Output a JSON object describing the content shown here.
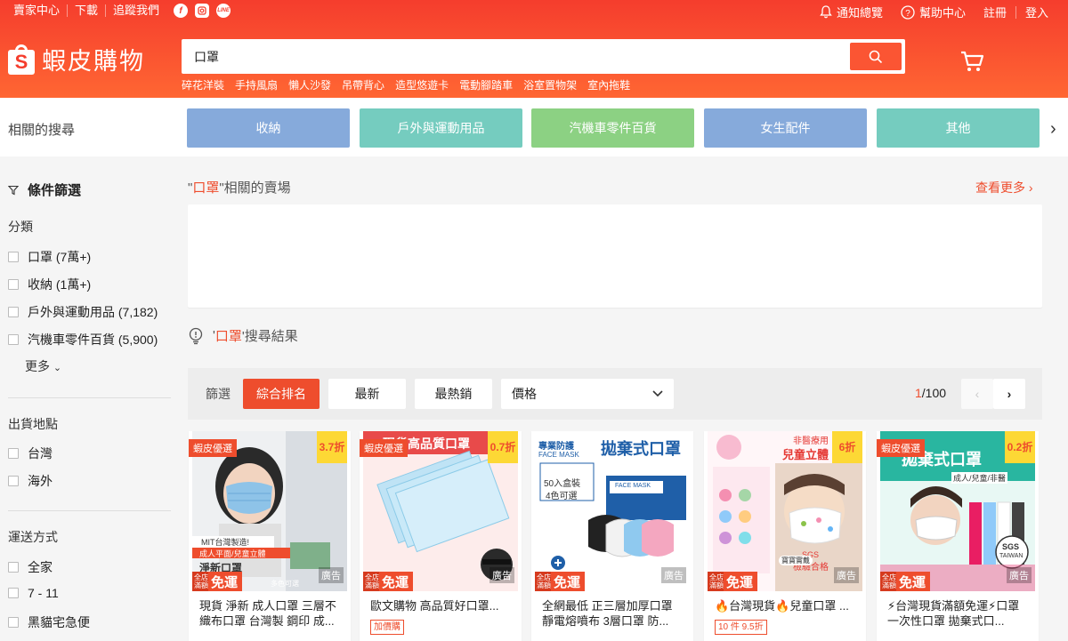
{
  "topbar": {
    "seller_center": "賣家中心",
    "download": "下載",
    "follow_us": "追蹤我們",
    "notifications": "通知總覽",
    "help_center": "幫助中心",
    "register": "註冊",
    "login": "登入"
  },
  "brand": {
    "logo_text": "蝦皮購物"
  },
  "search": {
    "query": "口罩",
    "hot_words": [
      "碎花洋裝",
      "手持風扇",
      "懶人沙發",
      "吊帶背心",
      "造型悠遊卡",
      "電動腳踏車",
      "浴室置物架",
      "室內拖鞋"
    ]
  },
  "related": {
    "label": "相關的搜尋",
    "categories": [
      {
        "label": "收納",
        "color": "#86aadb"
      },
      {
        "label": "戶外與運動用品",
        "color": "#75ccbf"
      },
      {
        "label": "汽機車零件百貨",
        "color": "#8cd183"
      },
      {
        "label": "女生配件",
        "color": "#86aadb"
      },
      {
        "label": "其他",
        "color": "#75ccbf"
      }
    ]
  },
  "filters": {
    "title": "條件篩選",
    "category_title": "分類",
    "categories": [
      "口罩 (7萬+)",
      "收納 (1萬+)",
      "戶外與運動用品 (7,182)",
      "汽機車零件百貨 (5,900)"
    ],
    "more": "更多",
    "location_title": "出貨地點",
    "locations": [
      "台灣",
      "海外"
    ],
    "shipping_title": "運送方式",
    "shipping": [
      "全家",
      "7 - 11",
      "黑貓宅急便"
    ]
  },
  "shops": {
    "heading_prefix": "\"",
    "keyword": "口罩",
    "heading_suffix": "\"相關的賣場",
    "see_more": "查看更多"
  },
  "results": {
    "prefix": "'",
    "keyword": "口罩",
    "suffix": "'搜尋結果"
  },
  "sort": {
    "label": "篩選",
    "relevance": "綜合排名",
    "latest": "最新",
    "top_sales": "最熱銷",
    "price": "價格",
    "page_current": "1",
    "page_total": "/100"
  },
  "products": [
    {
      "tag": "蝦皮優選",
      "discount": "3.7折",
      "ad": "廣告",
      "title": "現貨 淨新 成人口罩 三層不織布口罩 台灣製 鋼印 成...",
      "chip": "",
      "ship_small": "全店滿額",
      "ship_big": "免運"
    },
    {
      "tag": "蝦皮優選",
      "discount": "0.7折",
      "ad": "廣告",
      "title": "歐文購物 高品質好口罩...",
      "chip": "加價購",
      "ship_small": "全店滿額",
      "ship_big": "免運"
    },
    {
      "tag": "",
      "discount": "",
      "ad": "廣告",
      "title": "全網最低 正三層加厚口罩 靜電熔噴布 3層口罩 防...",
      "chip": "",
      "ship_small": "全店滿額",
      "ship_big": "免運"
    },
    {
      "tag": "",
      "discount": "6折",
      "ad": "廣告",
      "title": "🔥台灣現貨🔥兒童口罩 ...",
      "chip": "10 件 9.5折",
      "ship_small": "全店滿額",
      "ship_big": "免運"
    },
    {
      "tag": "蝦皮優選",
      "discount": "0.2折",
      "ad": "廣告",
      "title": "⚡台灣現貨滿額免運⚡口罩 一次性口罩 拋棄式口...",
      "chip": "",
      "ship_small": "全店滿額",
      "ship_big": "免運"
    }
  ],
  "image_text": {
    "p1_banner": "MIT台灣製造!",
    "p1_sub": "成人平面/兒童立體",
    "p1_name": "淨新口罩",
    "p1_foot": "多色可選",
    "p2_top": "現貨高品質口罩",
    "p3_title": "拋棄式口罩",
    "p3_left": "專業防護",
    "p3_en": "FACE MASK",
    "p3_box": "50入盒裝",
    "p3_color": "4色可選",
    "p3_boxlabel": "FACE MASK",
    "p4_top": "非醫療用",
    "p4_title": "兒童立體",
    "p4_sgs": "SGS",
    "p4_pass": "檢驗合格",
    "p4_caption": "寶寶實戴",
    "p5_title": "拋棄式口罩",
    "p5_sub": "成人/兒童/非醫",
    "p5_sgs": "SGS",
    "p5_tw": "TAIWAN"
  }
}
